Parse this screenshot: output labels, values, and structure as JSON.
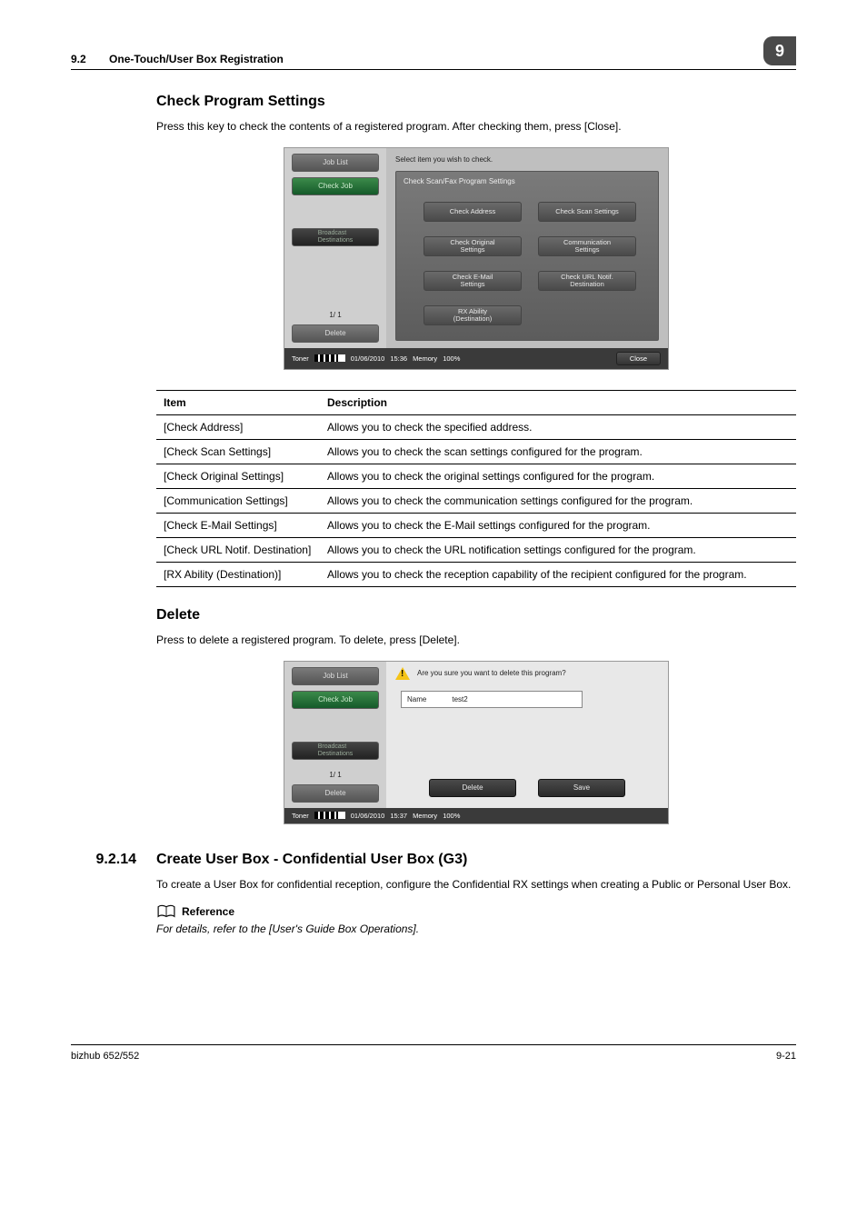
{
  "header": {
    "section_number": "9.2",
    "section_title": "One-Touch/User Box Registration",
    "chapter_badge": "9"
  },
  "s1": {
    "title": "Check Program Settings",
    "body": "Press this key to check the contents of a registered program. After checking them, press [Close]."
  },
  "shot1": {
    "job_list": "Job List",
    "check_job": "Check Job",
    "bdest": "Broadcast\nDestinations",
    "pager": "1/ 1",
    "delete": "Delete",
    "msg": "Select item you wish to check.",
    "panel_title": "Check Scan/Fax Program Settings",
    "btns": {
      "check_address": "Check Address",
      "check_scan": "Check Scan Settings",
      "check_original": "Check Original\nSettings",
      "communication": "Communication\nSettings",
      "check_email": "Check E-Mail\nSettings",
      "check_url": "Check URL Notif.\nDestination",
      "rx_ability": "RX Ability\n(Destination)"
    },
    "status": {
      "toner": "Toner",
      "date": "01/06/2010",
      "time": "15:36",
      "mem_label": "Memory",
      "mem_val": "100%",
      "close": "Close"
    }
  },
  "table": {
    "h_item": "Item",
    "h_desc": "Description",
    "rows": [
      {
        "item": "[Check Address]",
        "desc": "Allows you to check the specified address."
      },
      {
        "item": "[Check Scan Settings]",
        "desc": "Allows you to check the scan settings configured for the program."
      },
      {
        "item": "[Check Original Settings]",
        "desc": "Allows you to check the original settings configured for the program."
      },
      {
        "item": "[Communication Settings]",
        "desc": "Allows you to check the communication settings configured for the program."
      },
      {
        "item": "[Check E-Mail Settings]",
        "desc": "Allows you to check the E-Mail settings configured for the program."
      },
      {
        "item": "[Check URL Notif. Destination]",
        "desc": "Allows you to check the URL notification settings configured for the program."
      },
      {
        "item": "[RX Ability (Destination)]",
        "desc": "Allows you to check the reception capability of the recipient configured for the program."
      }
    ]
  },
  "s2": {
    "title": "Delete",
    "body": "Press to delete a registered program. To delete, press [Delete]."
  },
  "shot2": {
    "confirm": "Are you sure you want to delete this program?",
    "name_label": "Name",
    "name_value": "test2",
    "delete_btn": "Delete",
    "save_btn": "Save",
    "status": {
      "toner": "Toner",
      "date": "01/06/2010",
      "time": "15:37",
      "mem_label": "Memory",
      "mem_val": "100%"
    },
    "pager": "1/ 1",
    "left_delete": "Delete",
    "job_list": "Job List",
    "check_job": "Check Job",
    "bdest": "Broadcast\nDestinations"
  },
  "s3": {
    "number": "9.2.14",
    "title": "Create User Box - Confidential User Box (G3)",
    "body": "To create a User Box for confidential reception, configure the Confidential RX settings when creating a Public or Personal User Box.",
    "reference_label": "Reference",
    "reference_text": "For details, refer to the [User's Guide Box Operations]."
  },
  "footer": {
    "left": "bizhub 652/552",
    "right": "9-21"
  }
}
